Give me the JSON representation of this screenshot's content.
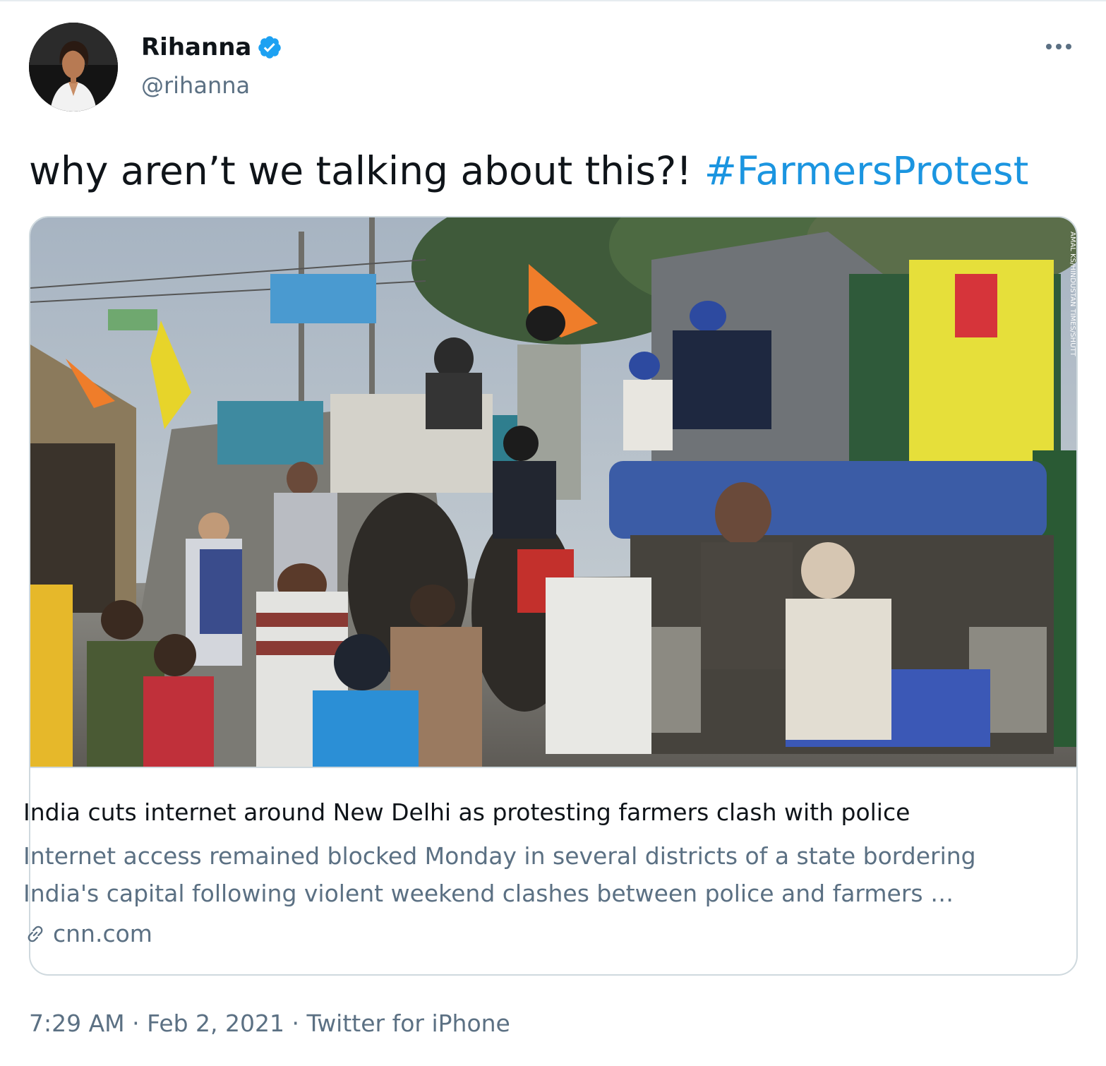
{
  "tweet": {
    "display_name": "Rihanna",
    "handle": "@rihanna",
    "text": "why aren’t we talking about this?! ",
    "hashtag": "#FarmersProtest",
    "accent_color": "#1b95e0",
    "verified_color": "#1da1f2",
    "more_icon": "more-horizontal-icon"
  },
  "card": {
    "image_credit": "AMAL KS/HINDUSTAN TIMES/SHUTT",
    "title": "India cuts internet around New Delhi as protesting farmers clash with police",
    "description_lines": [
      "Internet access remained blocked Monday in several districts of a state bordering",
      "India's capital following violent weekend clashes between police and farmers …"
    ],
    "domain": "cnn.com",
    "domain_icon": "link-icon"
  },
  "footer": {
    "time": "7:29 AM",
    "separator": " · ",
    "date": "Feb 2, 2021",
    "source": "Twitter for iPhone"
  }
}
